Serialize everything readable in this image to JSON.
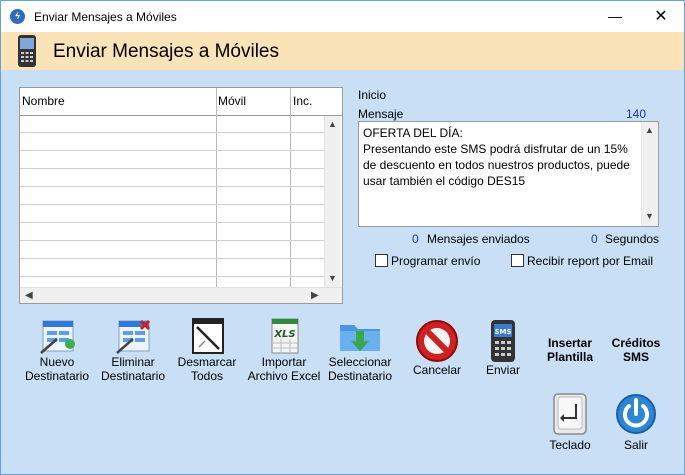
{
  "window": {
    "title": "Enviar Mensajes a Móviles",
    "minimize": "—",
    "close": "✕",
    "app_icon": "bolt-icon"
  },
  "header": {
    "title": "Enviar Mensajes a Móviles",
    "icon": "cellphone-icon"
  },
  "list": {
    "columns": [
      "Nombre",
      "Móvil",
      "Inc."
    ],
    "rows": []
  },
  "message": {
    "section_label": "Inicio",
    "label": "Mensaje",
    "char_count": "140",
    "text": "OFERTA DEL DÍA:\nPresentando este SMS podrá disfrutar de un 15% de descuento en todos nuestros productos, puede usar también el código DES15"
  },
  "stats": {
    "sent_count": "0",
    "sent_label": "Mensajes enviados",
    "seconds_count": "0",
    "seconds_label": "Segundos"
  },
  "options": {
    "schedule_label": "Programar envío",
    "schedule_checked": false,
    "report_label": "Recibir report por Email",
    "report_checked": false
  },
  "toolbar": {
    "new_recipient": [
      "Nuevo",
      "Destinatario"
    ],
    "delete_recipient": [
      "Eliminar",
      "Destinatario"
    ],
    "uncheck_all": [
      "Desmarcar",
      "Todos"
    ],
    "import_excel": [
      "Importar",
      "Archivo Excel"
    ],
    "select_recipient": [
      "Seleccionar",
      "Destinatario"
    ],
    "cancel": "Cancelar",
    "send": "Enviar",
    "insert_template": [
      "Insertar",
      "Plantilla"
    ],
    "sms_credits": [
      "Créditos",
      "SMS"
    ],
    "keyboard": "Teclado",
    "exit": "Salir",
    "excel_icon_text": "XLS",
    "sms_icon_text": "SMS"
  },
  "colors": {
    "header_band": "#fbe3b8",
    "window_bg": "#c9dff5",
    "count_blue": "#1a3c9c",
    "cancel_red": "#d21f1f"
  }
}
